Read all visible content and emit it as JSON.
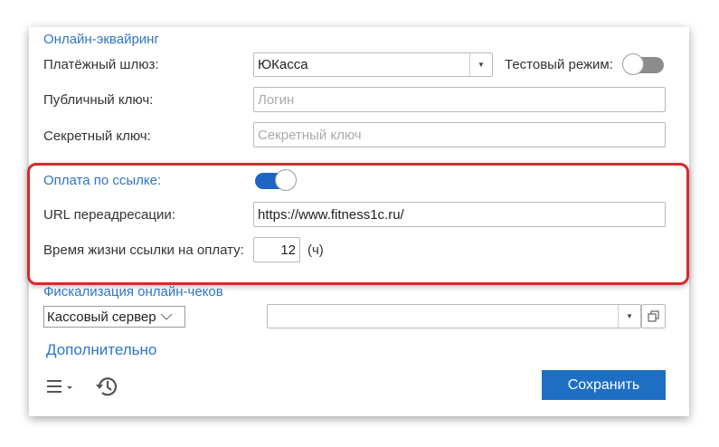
{
  "online_acquiring": {
    "section_title": "Онлайн-эквайринг",
    "gateway_label": "Платёжный шлюз:",
    "gateway_value": "ЮКасса",
    "test_mode_label": "Тестовый режим:",
    "test_mode_enabled": false,
    "public_key_label": "Публичный ключ:",
    "public_key_placeholder": "Логин",
    "secret_key_label": "Секретный ключ:",
    "secret_key_placeholder": "Секретный ключ"
  },
  "link_payment": {
    "label": "Оплата по ссылке:",
    "enabled": true,
    "redirect_url_label": "URL переадресации:",
    "redirect_url_value": "https://www.fitness1c.ru/",
    "link_lifetime_label": "Время жизни ссылки на оплату:",
    "link_lifetime_value": "12",
    "link_lifetime_unit": "(ч)"
  },
  "fiscalization": {
    "section_title": "Фискализация онлайн-чеков",
    "mode_value": "Кассовый сервер",
    "server_value": ""
  },
  "footer": {
    "more_link": "Дополнительно",
    "save_label": "Сохранить"
  },
  "icons": {
    "menu": "hamburger-menu-icon",
    "history": "history-icon"
  },
  "colors": {
    "accent": "#1e6fc3",
    "link": "#2e75c4",
    "highlight": "#d52b2b"
  }
}
